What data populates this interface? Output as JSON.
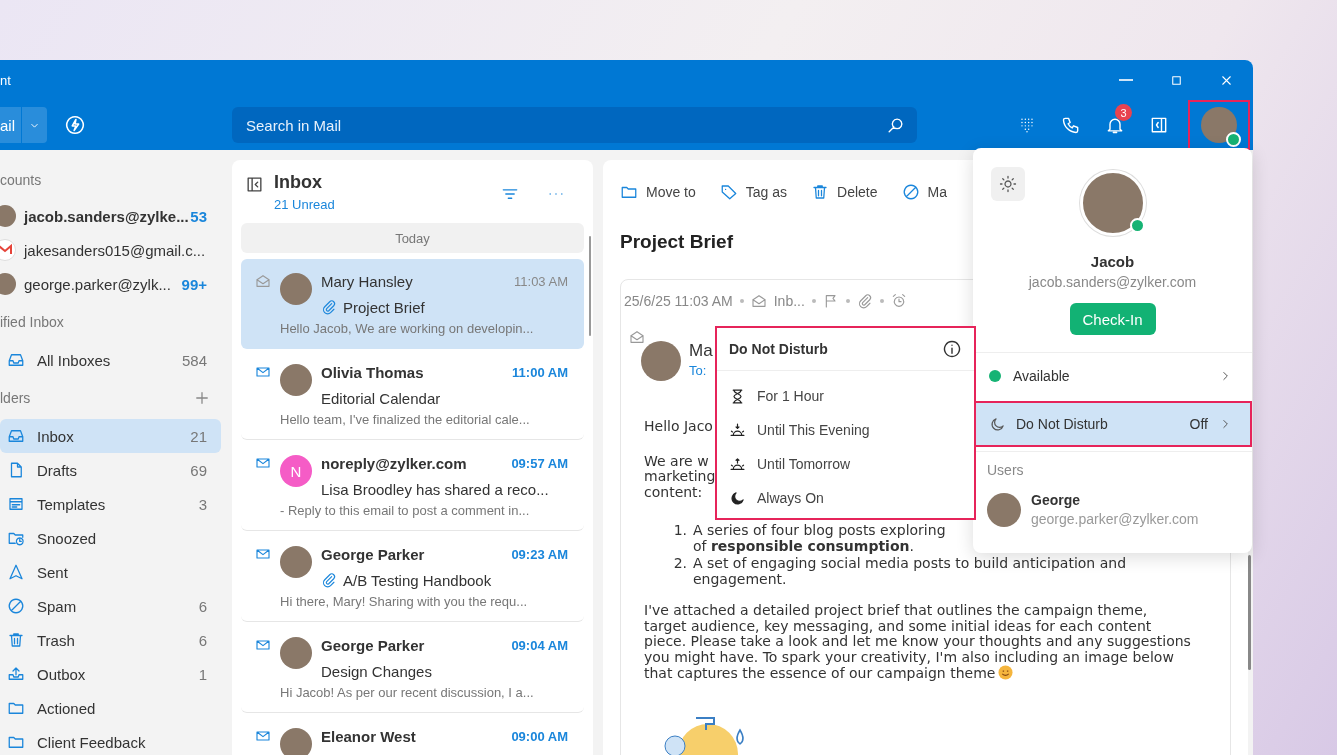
{
  "window": {
    "title": "nt"
  },
  "toolbar": {
    "new_mail": "ail",
    "search": {
      "placeholder": "Search in Mail"
    },
    "notifications_badge": "3",
    "avatar": {
      "online": true,
      "highlighted": true
    }
  },
  "sidebar": {
    "sections": [
      {
        "kind": "accounts",
        "title": "counts",
        "addable": false,
        "items": [
          {
            "kind": "photo",
            "label": "jacob.sanders@zylke...",
            "count": "53",
            "selected": true
          },
          {
            "kind": "gmail",
            "label": "jakesanders015@gmail.c...",
            "selected": false
          },
          {
            "kind": "photo",
            "label": "george.parker@zylk...",
            "count": "99+",
            "selected": false
          }
        ]
      },
      {
        "kind": "folders",
        "title": "ified Inbox",
        "addable": false,
        "items": [
          {
            "kind": "inbox",
            "label": "All Inboxes",
            "count": "584",
            "selected": false
          }
        ]
      },
      {
        "kind": "folders",
        "title": "lders",
        "addable": true,
        "items": [
          {
            "kind": "inbox",
            "label": "Inbox",
            "count": "21",
            "selected": true
          },
          {
            "kind": "drafts",
            "label": "Drafts",
            "count": "69",
            "selected": false
          },
          {
            "kind": "templates",
            "label": "Templates",
            "count": "3",
            "selected": false
          },
          {
            "kind": "snoozed",
            "label": "Snoozed",
            "selected": false
          },
          {
            "kind": "sent",
            "label": "Sent",
            "selected": false
          },
          {
            "kind": "spam",
            "label": "Spam",
            "count": "6",
            "selected": false
          },
          {
            "kind": "trash",
            "label": "Trash",
            "count": "6",
            "selected": false
          },
          {
            "kind": "outbox",
            "label": "Outbox",
            "count": "1",
            "selected": false
          },
          {
            "kind": "folder",
            "label": "Actioned",
            "selected": false
          },
          {
            "kind": "folder",
            "label": "Client Feedback",
            "selected": false
          }
        ]
      }
    ]
  },
  "mail_list": {
    "title": "Inbox",
    "subtitle": "21 Unread",
    "group": "Today",
    "messages": [
      {
        "sender": "Mary Hansley",
        "time": "11:03 AM",
        "subject": "Project Brief",
        "preview": "Hello Jacob, We are working on developin...",
        "unread": false,
        "attachment": true,
        "selected": true,
        "avatar": {
          "kind": "photo"
        }
      },
      {
        "sender": "Olivia Thomas",
        "time": "11:00 AM",
        "subject": "Editorial Calendar",
        "preview": "Hello team, I've finalized the editorial cale...",
        "unread": true,
        "attachment": false,
        "selected": false,
        "avatar": {
          "kind": "photo"
        }
      },
      {
        "sender": "noreply@zylker.com",
        "time": "09:57 AM",
        "subject": "Lisa Broodley has shared a reco...",
        "preview": "- Reply to this email to post a comment in...",
        "unread": true,
        "attachment": false,
        "selected": false,
        "avatar": {
          "kind": "initial",
          "initial": "N",
          "color": "#f55cc6"
        }
      },
      {
        "sender": "George Parker",
        "time": "09:23 AM",
        "subject": "A/B Testing Handbook",
        "preview": "Hi there, Mary! Sharing with you the requ...",
        "unread": true,
        "attachment": true,
        "selected": false,
        "avatar": {
          "kind": "photo"
        }
      },
      {
        "sender": "George Parker",
        "time": "09:04 AM",
        "subject": "Design Changes",
        "preview": "Hi Jacob! As per our recent discussion, I a...",
        "unread": true,
        "attachment": false,
        "selected": false,
        "avatar": {
          "kind": "photo"
        }
      },
      {
        "sender": "Eleanor West",
        "time": "09:00 AM",
        "unread": true,
        "attachment": false,
        "selected": false,
        "avatar": {
          "kind": "photo"
        }
      }
    ]
  },
  "reading_pane": {
    "actions": [
      {
        "kind": "move",
        "label": "Move to"
      },
      {
        "kind": "tag",
        "label": "Tag as"
      },
      {
        "kind": "delete",
        "label": "Delete"
      },
      {
        "kind": "block",
        "label": "Ma"
      }
    ],
    "subject": "Project Brief",
    "meta": {
      "date": "25/6/25 11:03 AM",
      "folder": "Inb..."
    },
    "sender": "Ma",
    "to": "To:",
    "greeting": "Hello Jaco",
    "intro_lines": [
      "We are w",
      "marketing",
      "content:"
    ],
    "list": [
      {
        "marker": "1.",
        "lines": [
          "A series of four blog posts exploring",
          "of **responsible consumption**."
        ]
      },
      {
        "marker": "2.",
        "lines": [
          "A set of engaging social media posts to build anticipation and",
          "engagement."
        ]
      }
    ],
    "paragraph": "I've attached a detailed project brief that outlines the campaign theme, target audience, key messaging, and some initial ideas for each content piece. Please take a look and let me know your thoughts and any suggestions you might have. To spark your creativity, I'm also including an image below that captures the essence of our campaign theme"
  },
  "profile": {
    "name": "Jacob",
    "email": "jacob.sanders@zylker.com",
    "online": true,
    "check_in": "Check-In",
    "status": {
      "label": "Available",
      "color": "#16b374"
    },
    "dnd": {
      "label": "Do Not Disturb",
      "value": "Off",
      "highlighted": true
    },
    "users_title": "Users",
    "users": [
      {
        "name": "George",
        "email": "george.parker@zylker.com"
      }
    ]
  },
  "dnd_menu": {
    "title": "Do Not Disturb",
    "options": [
      {
        "kind": "hour",
        "label": "For 1 Hour"
      },
      {
        "kind": "evening",
        "label": "Until This Evening"
      },
      {
        "kind": "tomorrow",
        "label": "Until Tomorrow"
      },
      {
        "kind": "always",
        "label": "Always On"
      }
    ]
  }
}
